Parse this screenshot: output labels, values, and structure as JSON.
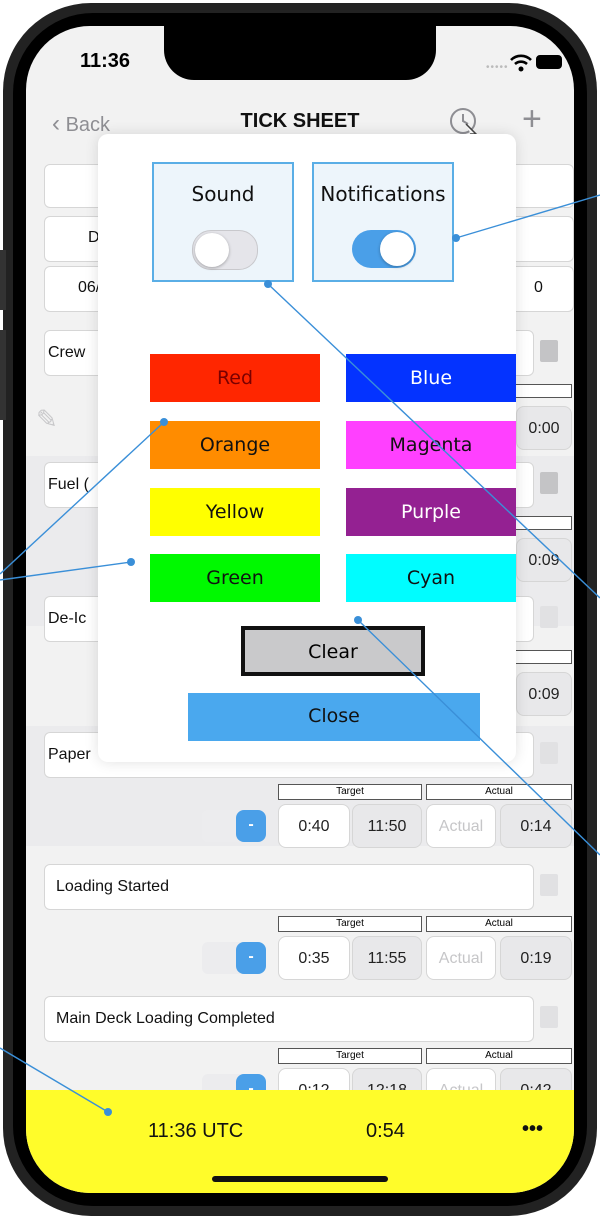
{
  "status_bar": {
    "time": "11:36"
  },
  "nav": {
    "back_label": "Back",
    "title": "TICK SHEET",
    "add_label": "+"
  },
  "background": {
    "partial_labels": [
      "D",
      "06/",
      "0",
      "Crew",
      "0:00",
      "Fuel (",
      "0:09",
      "De-Ic",
      "0:09",
      "Paper"
    ],
    "rows": [
      {
        "label": "Loading Started",
        "target_header": "Target",
        "actual_header": "Actual",
        "toggle": "-",
        "target_duration": "0:35",
        "target_time": "11:55",
        "actual_placeholder": "Actual",
        "actual_value": "0:19"
      },
      {
        "label": "Main Deck Loading Completed",
        "target_header": "Target",
        "actual_header": "Actual",
        "toggle": "-",
        "target_duration": "0:12",
        "target_time": "12:18",
        "actual_placeholder": "Actual",
        "actual_value": "0:42"
      }
    ],
    "paper_row": {
      "target_header": "Target",
      "actual_header": "Actual",
      "toggle": "-",
      "target_duration": "0:40",
      "target_time": "11:50",
      "actual_placeholder": "Actual",
      "actual_value": "0:14"
    }
  },
  "popup": {
    "sound": {
      "label": "Sound",
      "on": false
    },
    "notifications": {
      "label": "Notifications",
      "on": true
    },
    "colors": [
      {
        "label": "Red",
        "color": "#ff2600"
      },
      {
        "label": "Blue",
        "color": "#0433ff"
      },
      {
        "label": "Orange",
        "color": "#ff8c00"
      },
      {
        "label": "Magenta",
        "color": "#ff40ff"
      },
      {
        "label": "Yellow",
        "color": "#ffff00"
      },
      {
        "label": "Purple",
        "color": "#942192"
      },
      {
        "label": "Green",
        "color": "#00f900"
      },
      {
        "label": "Cyan",
        "color": "#00fdff"
      }
    ],
    "clear_label": "Clear",
    "close_label": "Close"
  },
  "footer": {
    "utc_time": "11:36 UTC",
    "elapsed": "0:54",
    "more_label": "•••"
  },
  "colors": {
    "accent_blue": "#4a9fe8",
    "footer_yellow": "#fffc2a",
    "callout_line": "#3a8fd8"
  }
}
